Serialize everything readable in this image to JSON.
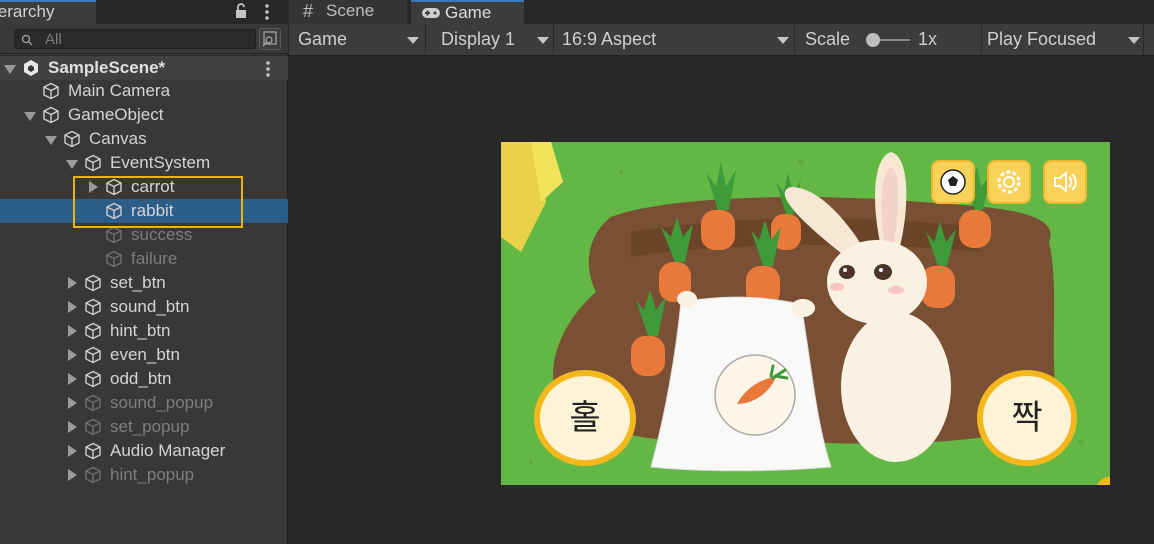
{
  "hierarchy": {
    "tab_label": "ierarchy",
    "search_placeholder": "All",
    "scene_name": "SampleScene*",
    "items": [
      {
        "label": "Main Camera"
      },
      {
        "label": "GameObject"
      },
      {
        "label": "Canvas"
      },
      {
        "label": "EventSystem"
      },
      {
        "label": "carrot"
      },
      {
        "label": "rabbit"
      },
      {
        "label": "success"
      },
      {
        "label": "failure"
      },
      {
        "label": "set_btn"
      },
      {
        "label": "sound_btn"
      },
      {
        "label": "hint_btn"
      },
      {
        "label": "even_btn"
      },
      {
        "label": "odd_btn"
      },
      {
        "label": "sound_popup"
      },
      {
        "label": "set_popup"
      },
      {
        "label": "Audio Manager"
      },
      {
        "label": "hint_popup"
      }
    ],
    "highlight_color": "#f0b400",
    "selection_color": "#2c5d87"
  },
  "tabs": {
    "scene": "Scene",
    "game": "Game"
  },
  "toolbar": {
    "mode": "Game",
    "display": "Display 1",
    "aspect": "16:9 Aspect",
    "scale_label": "Scale",
    "scale_value": "1x",
    "play_mode": "Play Focused"
  },
  "game": {
    "odd_button": "홀",
    "even_button": "짝",
    "icons": [
      "soccer-ball-icon",
      "gear-icon",
      "speaker-icon"
    ],
    "colors": {
      "grass": "#63b745",
      "button_ring": "#f5b81c",
      "button_fill": "#fdf4d8"
    }
  }
}
